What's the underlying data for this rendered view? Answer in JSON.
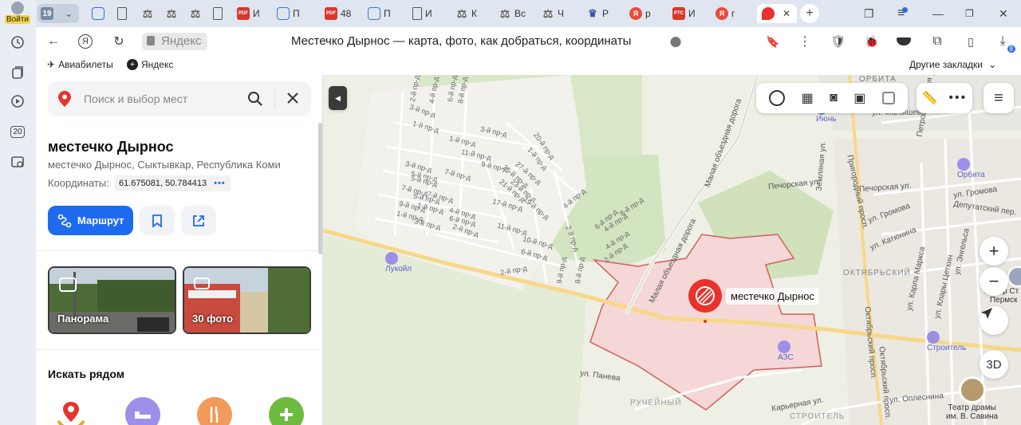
{
  "browser": {
    "profile_label": "Войти",
    "rail_badge": "20",
    "tabs": [
      {
        "label": "19",
        "icon": "tab-counter",
        "color": "#7a8aa5"
      },
      {
        "label": "И",
        "icon": "pdf-icon",
        "color": "#d9382b"
      },
      {
        "label": "П",
        "icon": "mail-icon",
        "color": "#3a75d9"
      },
      {
        "label": "48",
        "icon": "pdf-icon",
        "color": "#d9382b"
      },
      {
        "label": "П",
        "icon": "mail-icon",
        "color": "#3a75d9"
      },
      {
        "label": "И",
        "icon": "doc-icon",
        "color": "#666"
      },
      {
        "label": "К",
        "icon": "scales-icon",
        "color": "#666"
      },
      {
        "label": "Вс",
        "icon": "scales-icon",
        "color": "#666"
      },
      {
        "label": "Ч",
        "icon": "scales-icon",
        "color": "#666"
      },
      {
        "label": "Р",
        "icon": "emblem-icon",
        "color": "#3a58a8"
      },
      {
        "label": "р",
        "icon": "yandex-icon",
        "color": "#e84c3d"
      },
      {
        "label": "И",
        "icon": "rtc-icon",
        "color": "#d9382b"
      },
      {
        "label": "г",
        "icon": "yandex-icon",
        "color": "#e84c3d"
      }
    ],
    "address": {
      "domain": "Яндекс",
      "title": "Местечко Дырнос — карта, фото, как добраться, координаты"
    },
    "bookmarks": {
      "items": [
        "Авиабилеты",
        "Яндекс"
      ],
      "other": "Другие закладки"
    },
    "download_badge": "8"
  },
  "sidebar": {
    "search_placeholder": "Поиск и выбор мест",
    "place_title": "местечко Дырнос",
    "place_subtitle": "местечко Дырнос, Сыктывкар, Республика Коми",
    "coords_label": "Координаты:",
    "coords_value": "61.675081, 50.784413",
    "route_label": "Маршрут",
    "panorama_label": "Панорама",
    "photos_label": "30 фото",
    "nearby_title": "Искать рядом"
  },
  "map": {
    "selected_place": "местечко Дырнос",
    "zoom_3d": "3D",
    "district_labels": [
      "ОРБИТА",
      "ОКТЯБРЬСКИЙ",
      "РУЧЕЙНЫЙ",
      "СТРОИТЕЛЬ"
    ],
    "pois": [
      "Лукойл",
      "Июнь",
      "Орбита",
      "АЗС",
      "Строитель",
      "Собор Ст",
      "Пермск",
      "Театр драмы",
      "им. В. Савина"
    ],
    "streets": [
      "ул. Малышева",
      "Петрозаводская ул.",
      "Печорская ул.",
      "Печорская ул.",
      "ул. Громова",
      "ул. Громова",
      "Депутатский пер.",
      "ул. Катюнина",
      "Земляная ул.",
      "Пригородный просп.",
      "ул. Карла Маркса",
      "ул. Клары Цеткин",
      "ул. Энгельса",
      "Октябрьский просп.",
      "Октябрьский просп.",
      "Малая объездная дорога",
      "Малая объездная дорога",
      "ул. Панева",
      "Карьерная ул.",
      "ул. Оплеснина"
    ],
    "dacha_streets": [
      "2-й пр-д",
      "4-й пр-д",
      "6-й пр-д",
      "8-й пр-д",
      "3-й пр-д",
      "1-й пр-д",
      "3-й пр-д",
      "1-й пр-д",
      "11-й пр-д",
      "9-й пр-д",
      "5-й пр-д",
      "3-й пр-д",
      "7-й пр-д",
      "5-й пр-д",
      "7-й пр-д",
      "9-й пр-д",
      "1-й пр-д",
      "4-й пр-д",
      "2-й пр-д",
      "25-й пр-д",
      "27-й пр-д",
      "21-й пр-д",
      "23-й пр-д",
      "6-й пр-д",
      "17-й пр-д",
      "19-й пр-д",
      "20-й пр-д",
      "4-й пр-д",
      "8-й пр-д",
      "11-й пр-д",
      "10-й пр-д",
      "6-й пр-д",
      "2-й пр-д",
      "2-й пр-д",
      "4-й пр-д",
      "9-й пр-д",
      "8-й пр-д",
      "4-й пр-д",
      "2-й пр-д",
      "6-й пр-д",
      "1-й пр-д",
      "3-й пр-д",
      "5-й пр-д",
      "7-й пр-д",
      "1-й пр-д"
    ]
  },
  "colors": {
    "accent": "#1e6bf0",
    "marker": "#e8322b",
    "area_fill": "#f5d7d7",
    "area_border": "#d1605a"
  }
}
